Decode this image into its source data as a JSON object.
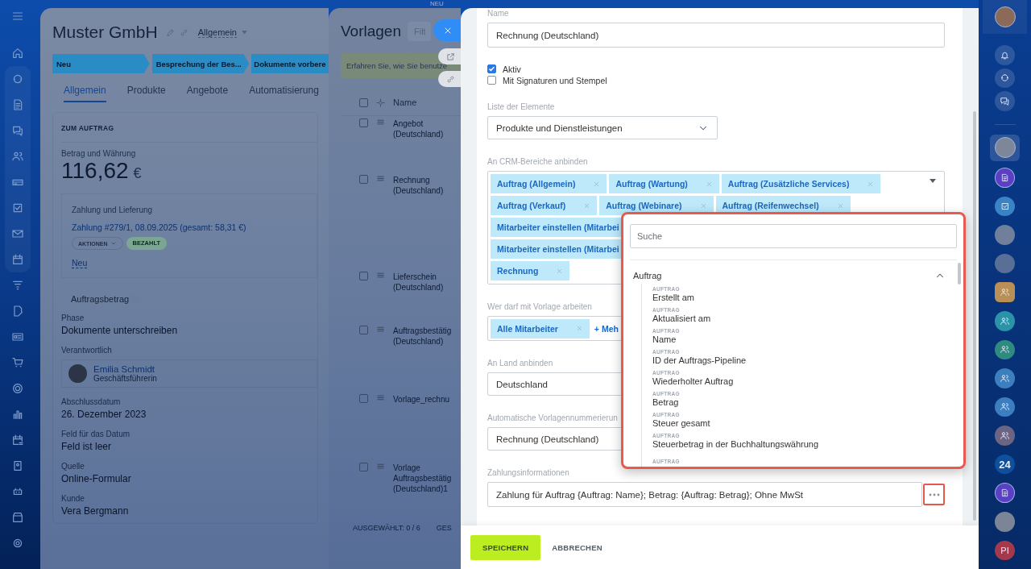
{
  "top_badge": "NEU",
  "deal": {
    "title": "Muster GmbH",
    "category": "Allgemein",
    "stages": [
      {
        "label": "Neu"
      },
      {
        "label": "Besprechung der Bes..."
      },
      {
        "label": "Dokumente vorbere"
      }
    ],
    "tabs": [
      {
        "label": "Allgemein",
        "selected": true
      },
      {
        "label": "Produkte",
        "selected": false
      },
      {
        "label": "Angebote",
        "selected": false
      },
      {
        "label": "Automatisierung",
        "selected": false
      }
    ],
    "section_title": "ZUM AUFTRAG",
    "amount_label": "Betrag und Währung",
    "amount": "116,62",
    "currency": "€",
    "payment": {
      "title": "Zahlung und Lieferung",
      "link": "Zahlung #279/1, 08.09.2025 (gesamt: 58,31 €)",
      "actions": "AKTIONEN",
      "status": "BEZAHLT",
      "new_link": "Neu",
      "total_label": "Auftragsbetrag"
    },
    "fields": [
      {
        "kind": "text",
        "label": "Phase",
        "value": "Dokumente unterschreiben"
      },
      {
        "kind": "person",
        "label": "Verantwortlich",
        "name": "Emilia Schmidt",
        "role": "Geschäftsführerin"
      },
      {
        "kind": "text",
        "label": "Abschlussdatum",
        "value": "26. Dezember 2023"
      },
      {
        "kind": "text",
        "label": "Feld für das Datum",
        "value": "Feld ist leer"
      },
      {
        "kind": "text",
        "label": "Quelle",
        "value": "Online-Formular"
      },
      {
        "kind": "text",
        "label": "Kunde",
        "value": "Vera Bergmann"
      }
    ]
  },
  "templates": {
    "title": "Vorlagen",
    "filter_placeholder": "Filt",
    "banner": "Erfahren Sie, wie Sie benutze",
    "select_all_checked": false,
    "column": "Name",
    "rows": [
      {
        "name": "Angebot (Deutschland)",
        "checked": false
      },
      {
        "name": "Rechnung (Deutschland)",
        "checked": false
      },
      {
        "name": "Lieferschein (Deutschland)",
        "checked": false
      },
      {
        "name": "Auftragsbestätig (Deutschland)",
        "checked": false
      },
      {
        "name": "Vorlage_rechnu",
        "checked": false
      },
      {
        "name": "Vorlage Auftragsbestätig (Deutschland)1",
        "checked": false
      }
    ],
    "footer": "AUSGEWÄHLT: 0 / 6",
    "footer_2": "GES"
  },
  "form": {
    "name_label": "Name",
    "name_value": "Rechnung (Deutschland)",
    "options": [
      {
        "label": "Aktiv",
        "checked": true
      },
      {
        "label": "Mit Signaturen und Stempel",
        "checked": false
      }
    ],
    "list_label": "Liste der Elemente",
    "list_value": "Produkte und Dienstleistungen",
    "crm_label": "An CRM-Bereiche anbinden",
    "crm_tag_rows": [
      [
        {
          "label": "Auftrag (Allgemein)"
        },
        {
          "label": "Auftrag (Wartung)"
        },
        {
          "label": "Auftrag (Zusätzliche Services)"
        }
      ],
      [
        {
          "label": "Auftrag (Verkauf)"
        },
        {
          "label": "Auftrag (Webinare)"
        },
        {
          "label": "Auftrag (Reifenwechsel)"
        }
      ],
      [
        {
          "label": "Mitarbeiter einstellen (Mitarbei"
        }
      ],
      [
        {
          "label": "Mitarbeiter einstellen (Mitarbei"
        }
      ],
      [
        {
          "label": "Rechnung"
        }
      ]
    ],
    "access_label": "Wer darf mit Vorlage arbeiten",
    "access_tags": [
      {
        "label": "Alle Mitarbeiter"
      }
    ],
    "access_more": "+ Meh",
    "country_label": "An Land anbinden",
    "country_value": "Deutschland",
    "numbering_label": "Automatische Vorlagennummerierun",
    "numbering_value": "Rechnung (Deutschland)",
    "payment_label": "Zahlungsinformationen",
    "payment_value": "Zahlung für Auftrag {Auftrag: Name}; Betrag: {Auftrag: Betrag}; Ohne MwSt",
    "buttons": [
      {
        "label": "SPEICHERN",
        "kind": "primary"
      },
      {
        "label": "ABBRECHEN",
        "kind": "link"
      }
    ]
  },
  "picker": {
    "search_placeholder": "Suche",
    "group": {
      "label": "Auftrag",
      "expanded": true,
      "items": [
        {
          "caption": "AUFTRAG",
          "label": "Erstellt am"
        },
        {
          "caption": "AUFTRAG",
          "label": "Aktualisiert am"
        },
        {
          "caption": "AUFTRAG",
          "label": "Name"
        },
        {
          "caption": "AUFTRAG",
          "label": "ID der Auftrags-Pipeline"
        },
        {
          "caption": "AUFTRAG",
          "label": "Wiederholter Auftrag"
        },
        {
          "caption": "AUFTRAG",
          "label": "Betrag"
        },
        {
          "caption": "AUFTRAG",
          "label": "Steuer gesamt"
        },
        {
          "caption": "AUFTRAG",
          "label": "Steuerbetrag in der Buchhaltungswährung"
        },
        {
          "caption": "AUFTRAG"
        }
      ]
    }
  },
  "right_bar": {
    "counter_label": "24",
    "initials": "PI"
  }
}
